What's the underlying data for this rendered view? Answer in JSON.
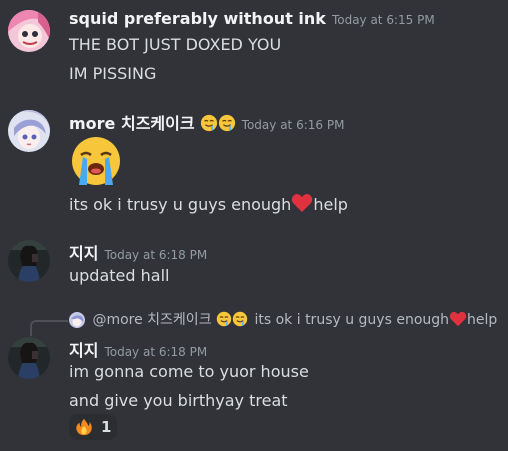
{
  "messages": [
    {
      "author": "squid preferably without ink",
      "timestamp": "Today at 6:15 PM",
      "lines": [
        "THE BOT JUST DOXED YOU",
        "IM PISSING"
      ]
    },
    {
      "author": "more 치즈케이크",
      "author_emoji": [
        "drooling-face",
        "drooling-face"
      ],
      "timestamp": "Today at 6:16 PM",
      "big_emoji": "loudly-crying-face",
      "line_before_heart": "its ok i trusy u guys enough",
      "line_after_heart": "help"
    },
    {
      "author": "지지",
      "timestamp": "Today at 6:18 PM",
      "lines": [
        "updated hall"
      ]
    },
    {
      "reply": {
        "mention": "@more 치즈케이크",
        "text_before_heart": "its ok i trusy u guys enough",
        "text_after_heart": "help"
      },
      "author": "지지",
      "timestamp": "Today at 6:18 PM",
      "lines": [
        "im gonna come to yuor house",
        "and give you birthyay treat"
      ],
      "reaction": {
        "emoji": "fire",
        "count": "1"
      }
    }
  ],
  "colors": {
    "background": "#313338",
    "username": "#f2f3f5",
    "text": "#dbdee1",
    "timestamp": "#949ba4",
    "reaction_bg": "#2b2d31",
    "heart": "#e0313f"
  }
}
